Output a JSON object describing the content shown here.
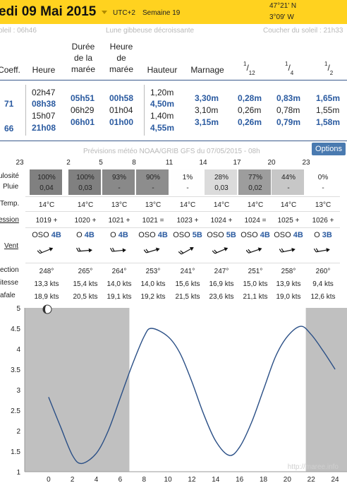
{
  "header": {
    "date": "edi 09 Mai 2015",
    "utc": "UTC+2",
    "week": "Semaine 19",
    "lat": "47°21' N",
    "lon": "3°09' W"
  },
  "sun": {
    "rise": "oleil : 06h46",
    "moon": "Lune gibbeuse décroissante",
    "set": "Coucher du soleil : 21h33"
  },
  "columns": {
    "coeff": "Coeff.",
    "heure": "Heure",
    "duree1": "Durée",
    "duree2": "de la",
    "duree3": "marée",
    "hmaree1": "Heure",
    "hmaree2": "de",
    "hmaree3": "marée",
    "hauteur": "Hauteur",
    "marnage": "Marnage",
    "f12_num": "1",
    "f12_den": "12",
    "f4_num": "1",
    "f4_den": "4",
    "f2_num": "1",
    "f2_den": "2"
  },
  "tides": {
    "coeff1": "71",
    "coeff2": "66",
    "heures": [
      "02h47",
      "08h38",
      "15h07",
      "21h08"
    ],
    "durees": [
      "05h51",
      "06h29",
      "06h01"
    ],
    "heures_maree": [
      "00h58",
      "01h04",
      "01h00"
    ],
    "hauteurs": [
      "1,20m",
      "4,50m",
      "1,40m",
      "4,55m"
    ],
    "marnages": [
      "3,30m",
      "3,10m",
      "3,15m"
    ],
    "douzieme": [
      "0,28m",
      "0,26m",
      "0,26m"
    ],
    "quart": [
      "0,83m",
      "0,78m",
      "0,79m"
    ],
    "demi": [
      "1,65m",
      "1,55m",
      "1,58m"
    ]
  },
  "meteo": {
    "title": "Prévisions météo NOAA/GRIB GFS du 07/05/2015 - 08h",
    "options": "Options",
    "hours": [
      "23",
      "2",
      "5",
      "8",
      "11",
      "14",
      "17",
      "20",
      "23"
    ],
    "labels": {
      "nebulosite": "ulosité",
      "pluie": "Pluie",
      "temp": "Temp.",
      "pression": "ession",
      "vent": "Vent",
      "direction": "ection",
      "vitesse": "itesse",
      "rafale": "afale"
    },
    "nebulosite": [
      "100%",
      "100%",
      "93%",
      "90%",
      "1%",
      "28%",
      "77%",
      "44%",
      "0%"
    ],
    "nebulosite_level": [
      1.0,
      1.0,
      0.93,
      0.9,
      0.01,
      0.28,
      0.77,
      0.44,
      0.0
    ],
    "pluie": [
      "0,04",
      "0,03",
      "-",
      "-",
      "-",
      "0,03",
      "0,02",
      "-",
      "-"
    ],
    "temp": [
      "14°C",
      "14°C",
      "13°C",
      "13°C",
      "14°C",
      "14°C",
      "14°C",
      "14°C",
      "13°C"
    ],
    "pression": [
      "1019 +",
      "1020 +",
      "1021 +",
      "1021 =",
      "1023 +",
      "1024 +",
      "1024 =",
      "1025 +",
      "1026 +"
    ],
    "vent_dir": [
      "OSO",
      "O",
      "O",
      "OSO",
      "OSO",
      "OSO",
      "OSO",
      "OSO",
      "O"
    ],
    "vent_force": [
      "4B",
      "4B",
      "4B",
      "4B",
      "5B",
      "5B",
      "4B",
      "4B",
      "3B"
    ],
    "direction": [
      "248°",
      "265°",
      "264°",
      "253°",
      "241°",
      "247°",
      "251°",
      "258°",
      "260°"
    ],
    "direction_deg": [
      248,
      265,
      264,
      253,
      241,
      247,
      251,
      258,
      260
    ],
    "vitesse": [
      "13,3 kts",
      "15,4 kts",
      "14,0 kts",
      "14,0 kts",
      "15,6 kts",
      "16,9 kts",
      "15,0 kts",
      "13,9 kts",
      "9,4 kts"
    ],
    "rafale": [
      "18,9 kts",
      "20,5 kts",
      "19,1 kts",
      "19,2 kts",
      "21,5 kts",
      "23,6 kts",
      "21,1 kts",
      "19,0 kts",
      "12,6 kts"
    ]
  },
  "chart_data": {
    "type": "line",
    "title": "",
    "xlabel": "",
    "ylabel": "",
    "xlim": [
      -2,
      25
    ],
    "ylim": [
      1,
      5
    ],
    "x_ticks": [
      0,
      2,
      4,
      6,
      8,
      10,
      12,
      14,
      16,
      18,
      20,
      22,
      24
    ],
    "y_ticks": [
      1,
      1.5,
      2,
      2.5,
      3,
      3.5,
      4,
      4.5,
      5
    ],
    "night_periods": [
      [
        -2,
        6.77
      ],
      [
        21.55,
        25
      ]
    ],
    "tide_extrema": [
      {
        "time": 2.78,
        "height": 1.2
      },
      {
        "time": 8.63,
        "height": 4.5
      },
      {
        "time": 15.12,
        "height": 1.4
      },
      {
        "time": 21.13,
        "height": 4.55
      }
    ],
    "series": [
      {
        "x": [
          0,
          1,
          2,
          2.78,
          4,
          5,
          6,
          7,
          8,
          8.63,
          10,
          11,
          12,
          13,
          14,
          15.12,
          16,
          17,
          18,
          19,
          20,
          21.13,
          22,
          23,
          24
        ],
        "values": [
          2.82,
          2.1,
          1.4,
          1.2,
          1.45,
          2.0,
          2.8,
          3.6,
          4.3,
          4.5,
          4.3,
          3.9,
          3.2,
          2.4,
          1.75,
          1.4,
          1.6,
          2.2,
          3.0,
          3.8,
          4.3,
          4.55,
          4.35,
          3.95,
          3.5
        ]
      }
    ],
    "line_color": "#2a4f86",
    "night_color": "#c0c0c0",
    "watermark": "http://maree.info"
  }
}
